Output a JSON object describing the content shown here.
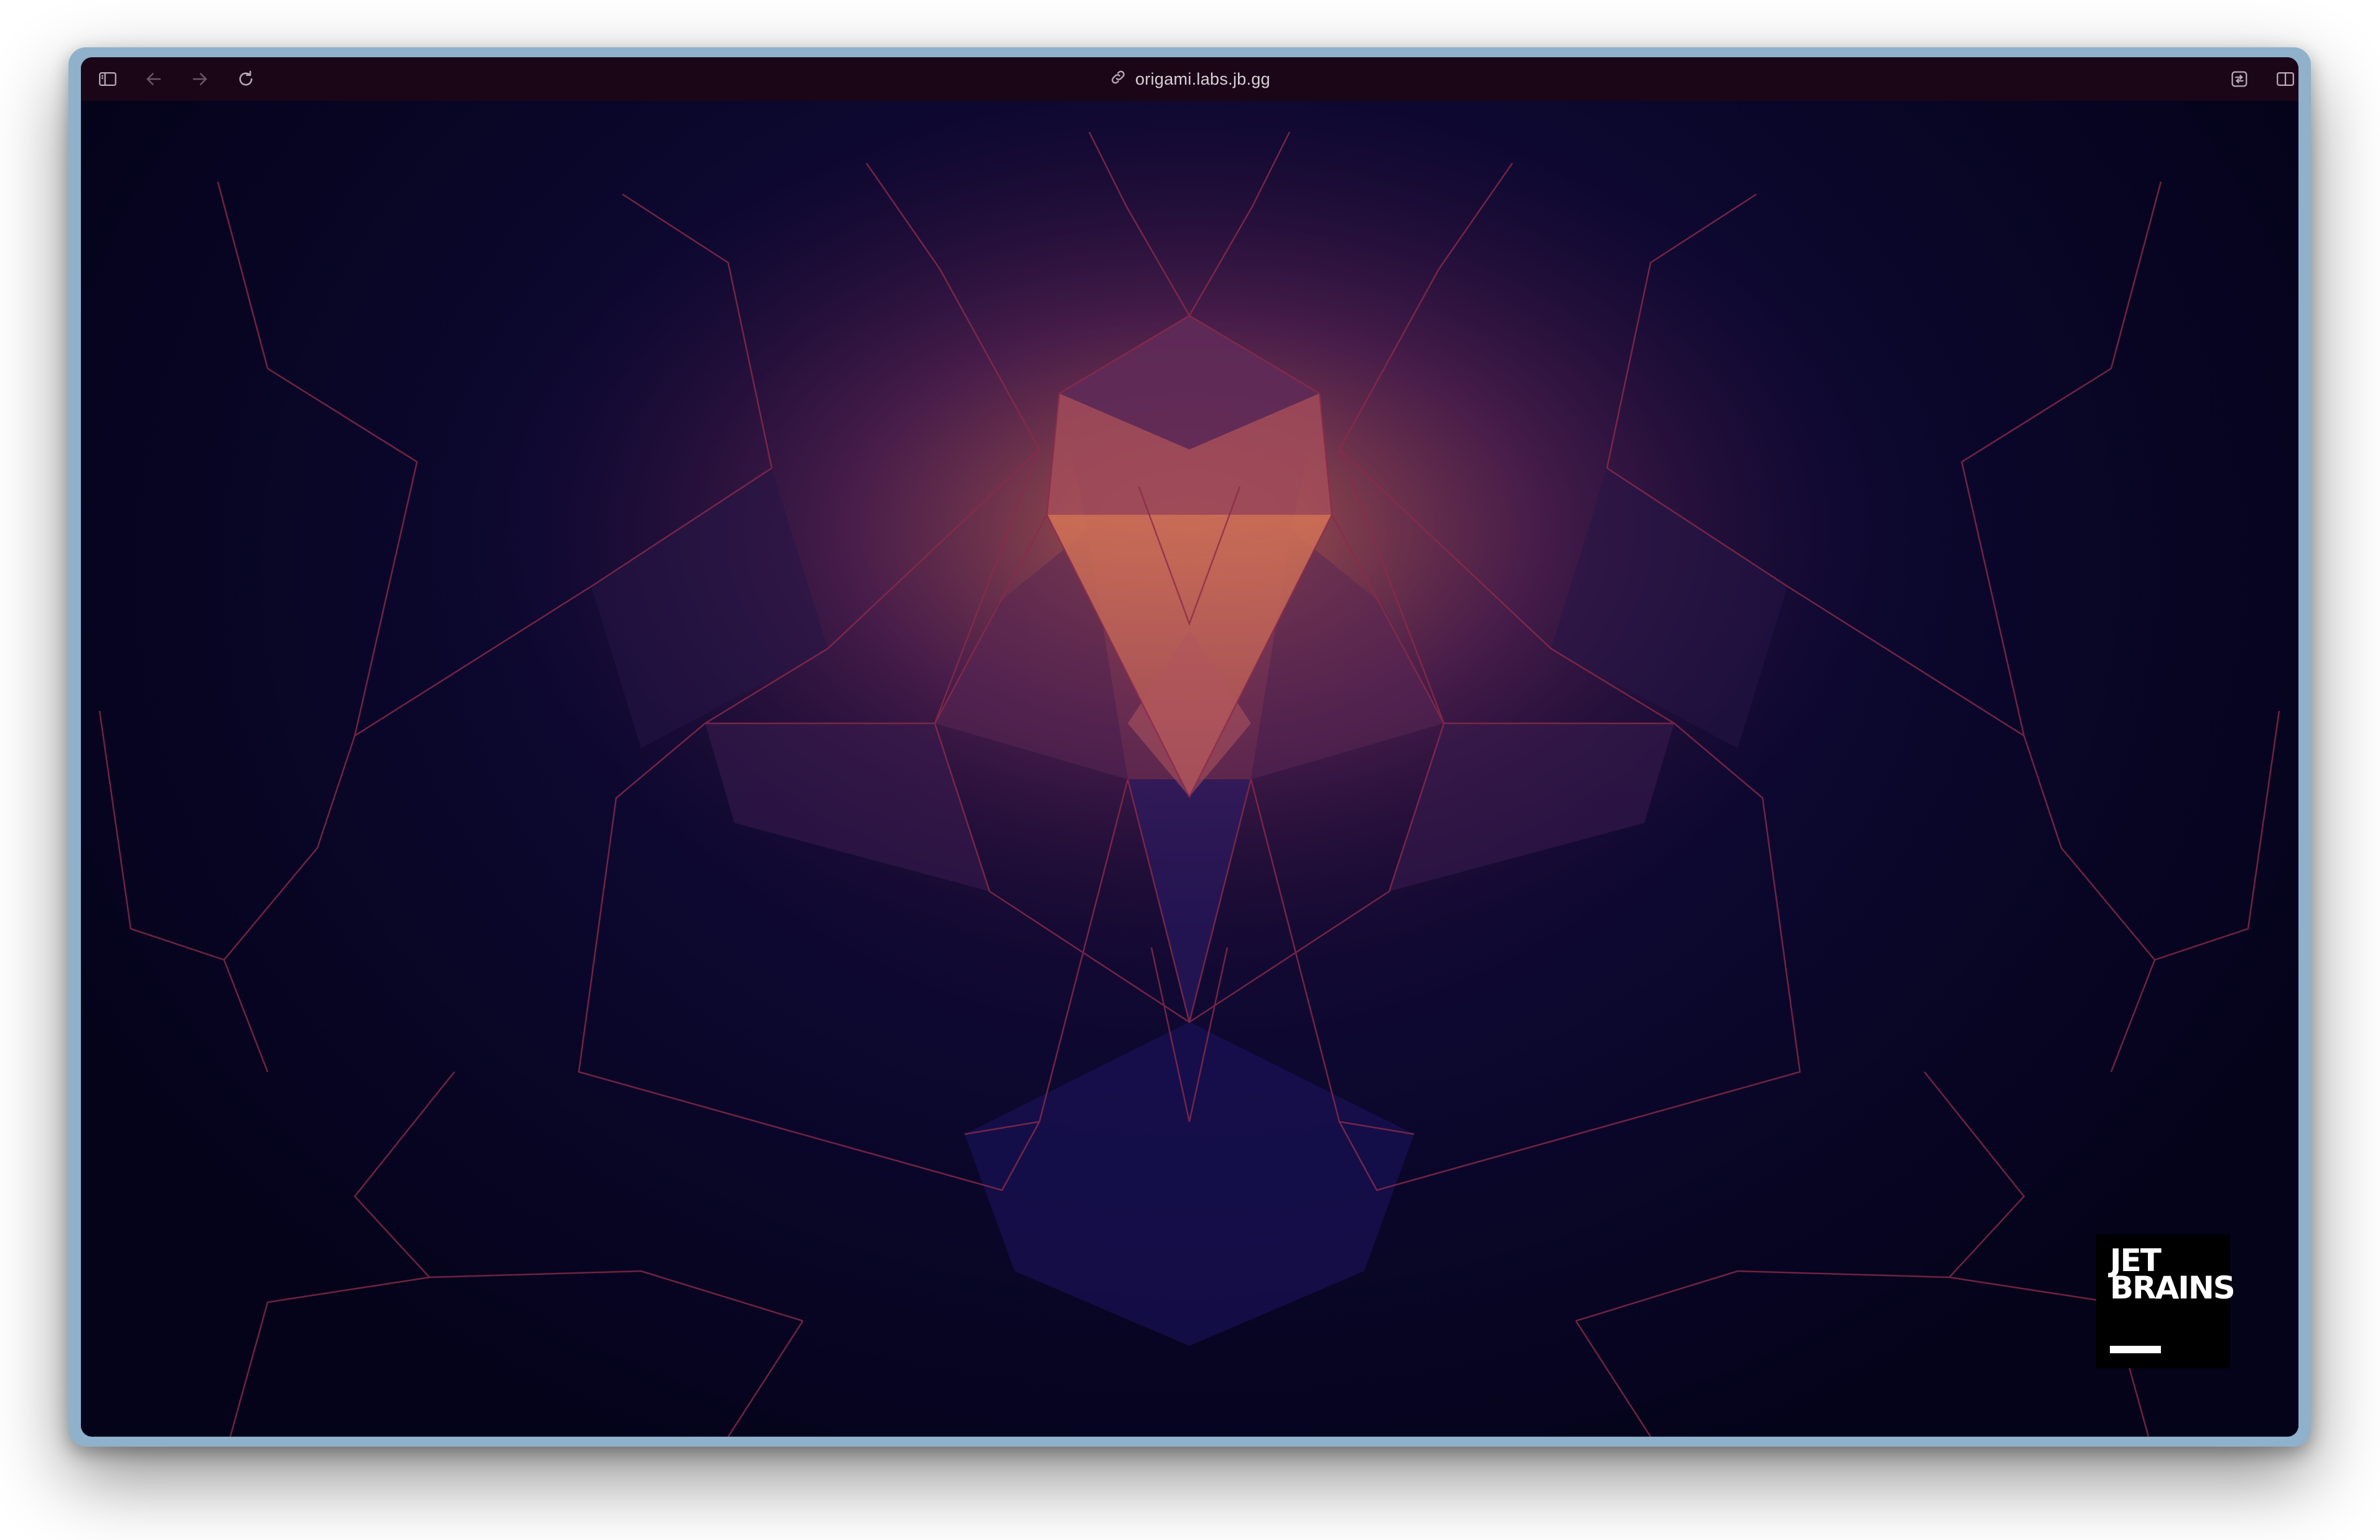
{
  "browser": {
    "url": "origami.labs.jb.gg",
    "icons": {
      "sidebar": "sidebar-icon",
      "back": "back-arrow-icon",
      "forward": "forward-arrow-icon",
      "reload": "reload-icon",
      "link": "link-icon",
      "reader": "reader-icon",
      "split": "split-view-icon"
    }
  },
  "page": {
    "logo_line1": "JET",
    "logo_line2": "BRAINS"
  },
  "colors": {
    "toolbar": "#1b0618",
    "background": "#05031c",
    "accent_orange": "#c4664f",
    "accent_purple": "#5a2a6a",
    "line": "#8c2a4a"
  }
}
